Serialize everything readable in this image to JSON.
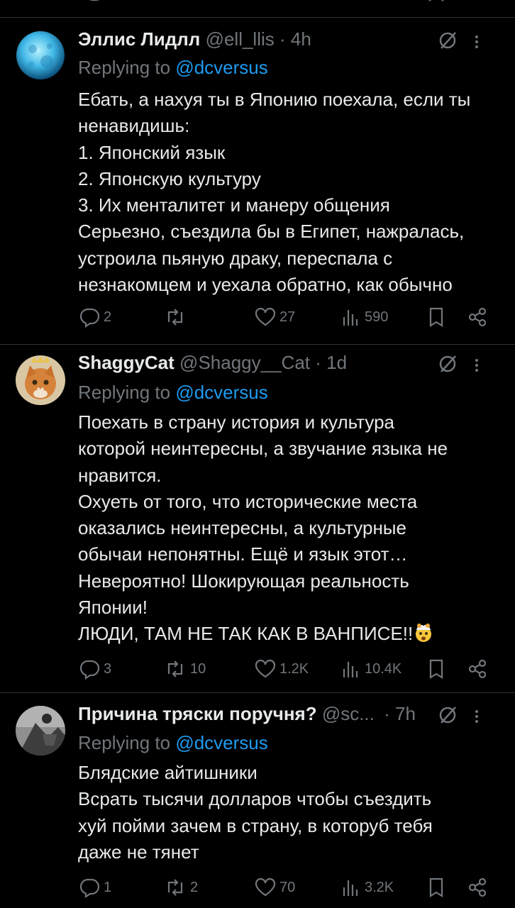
{
  "tweets": [
    {
      "name": "Эллис Лидлл",
      "handle": "@ell_llis",
      "dot": "·",
      "time": "4h",
      "replying_prefix": "Replying to ",
      "replying_to": "@dcversus",
      "text": "Ебать, а нахуя ты в Японию поехала, если ты\nненавидишь:\n1. Японский язык\n2. Японскую культуру\n3. Их менталитет и манеру общения\nСерьезно, съездила бы в Египет, нажралась,\nустроила пьяную драку, переспала с\nнезнакомцем и уехала обратно, как обычно",
      "replies": "2",
      "reposts": "",
      "likes": "27",
      "views": "590",
      "avatar": "moon-avatar"
    },
    {
      "name": "ShaggyCat",
      "handle": "@Shaggy__Cat",
      "dot": "·",
      "time": "1d",
      "replying_prefix": "Replying to ",
      "replying_to": "@dcversus",
      "text": "Поехать в страну история и культура\nкоторой неинтересны, а звучание языка не\nнравится.\nОхуеть от того, что исторические места\nоказались неинтересны, а культурные\nобычаи непонятны. Ещё и язык этот…\nНевероятно! Шокирующая реальность\nЯпонии!\nЛЮДИ, ТАМ НЕ ТАК КАК В ВАНПИСЕ!!",
      "emoji": "exploding-head-emoji",
      "replies": "3",
      "reposts": "10",
      "likes": "1.2K",
      "views": "10.4K",
      "avatar": "cat-with-crown-avatar"
    },
    {
      "name": "Причина тряски поручня?",
      "handle": "@sc...",
      "dot": "·",
      "time": "7h",
      "replying_prefix": "Replying to ",
      "replying_to": "@dcversus",
      "text": "Блядские айтишники\nВсрать тысячи долларов чтобы съездить\nхуй пойми зачем в страну, в которуб тебя\nдаже не тянет",
      "replies": "1",
      "reposts": "2",
      "likes": "70",
      "views": "3.2K",
      "avatar": "grayscale-photo-avatar"
    }
  ],
  "colors": {
    "background": "#000000",
    "text": "#e7e9ea",
    "muted": "#71767b",
    "link": "#1d9bf0",
    "divider": "#2f3336"
  }
}
